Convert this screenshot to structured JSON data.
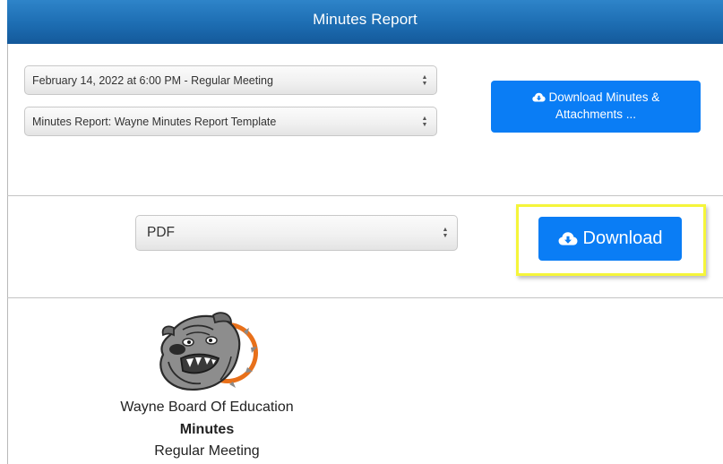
{
  "header": {
    "title": "Minutes Report"
  },
  "selectors": {
    "meeting": "February 14, 2022 at 6:00 PM - Regular Meeting",
    "template": "Minutes Report: Wayne Minutes Report Template",
    "format": "PDF"
  },
  "buttons": {
    "download_minutes_line1": "Download Minutes &",
    "download_minutes_line2": "Attachments ...",
    "download": "Download"
  },
  "report_preview": {
    "organization": "Wayne Board Of Education",
    "document_type": "Minutes",
    "meeting_type": "Regular Meeting",
    "logo": "bulldog-logo"
  },
  "icons": {
    "download": "cloud-download-icon",
    "select_arrows": "up-down-arrows-icon"
  },
  "colors": {
    "header": "#1d6db2",
    "primary_button": "#0a7df5",
    "highlight": "#f5f53a"
  }
}
